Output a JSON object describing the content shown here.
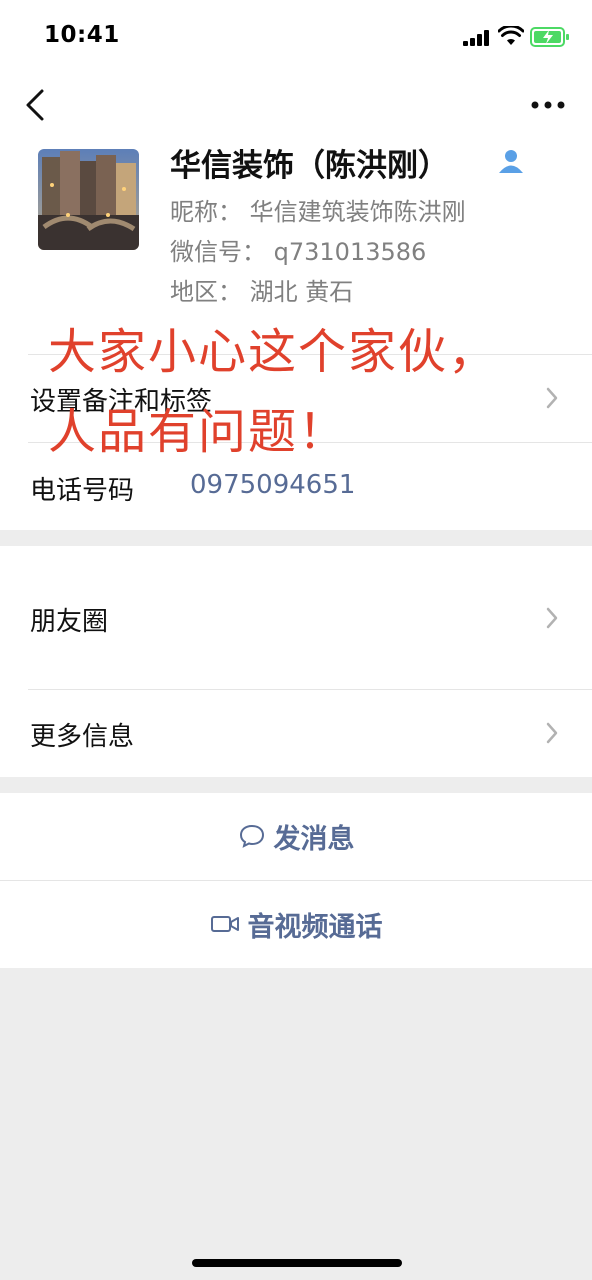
{
  "status_bar": {
    "time": "10:41",
    "icons": [
      "signal-icon",
      "wifi-icon",
      "battery-charging-icon"
    ],
    "battery_color": "#4cd964"
  },
  "nav": {
    "back_icon": "chevron-left-icon",
    "more_icon": "more-dots-icon"
  },
  "profile": {
    "name": "华信装饰（陈洪刚）",
    "badge_icon": "contact-person-icon",
    "nickname_line": "昵称：  华信建筑装饰陈洪刚",
    "wechat_id_line": "微信号：  q731013586",
    "region_line": "地区：  湖北 黄石"
  },
  "overlay": {
    "line1": "大家小心这个家伙，",
    "line2": "人品有问题！",
    "color": "#e0412c"
  },
  "rows": {
    "remarks_label": "设置备注和标签",
    "phone_label": "电话号码",
    "phone_value": "0975094651",
    "moments_label": "朋友圈",
    "more_info_label": "更多信息"
  },
  "actions": {
    "message_label": "发消息",
    "message_icon": "chat-bubble-icon",
    "call_label": "音视频通话",
    "call_icon": "video-camera-icon"
  },
  "colors": {
    "link_blue": "#576b95",
    "background": "#ededed",
    "secondary_text": "#808080"
  }
}
